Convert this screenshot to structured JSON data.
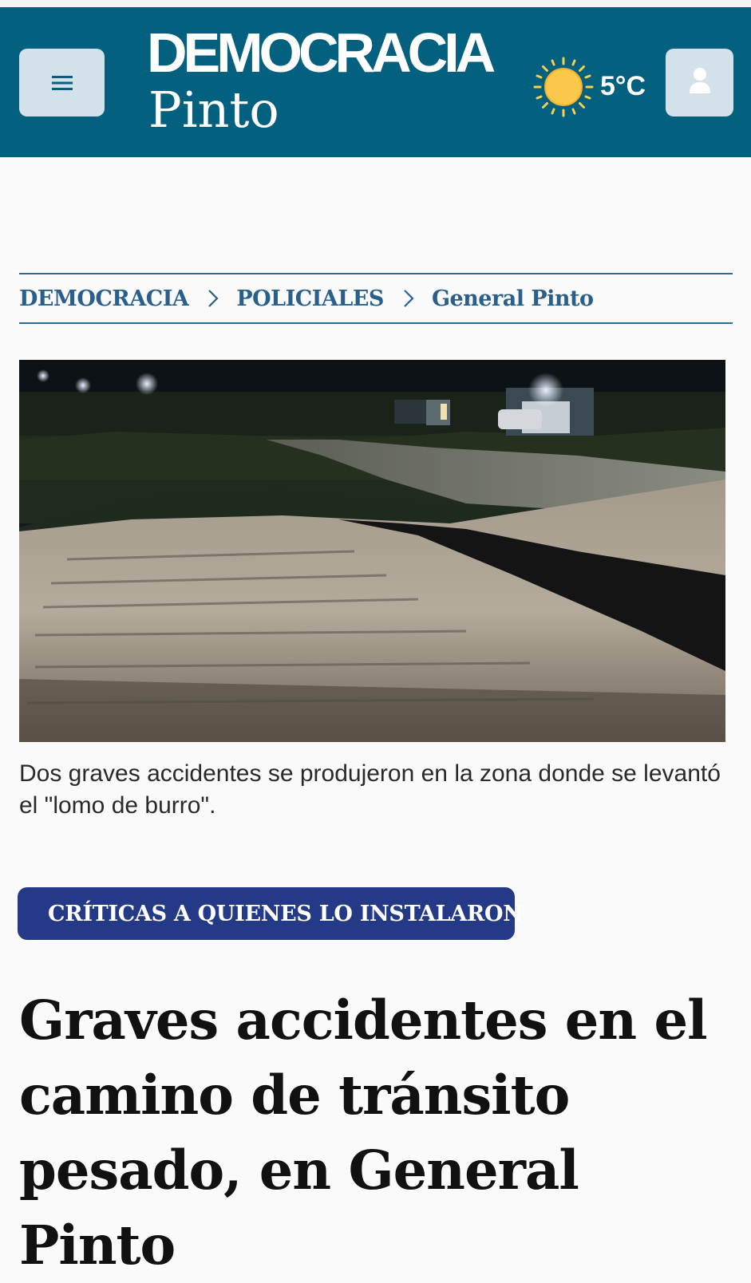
{
  "header": {
    "logo_top": "DEMOCRACIA",
    "logo_bottom": "Pinto",
    "temperature": "5°C",
    "menu_icon": "hamburger-menu-icon",
    "weather_icon": "sun-icon",
    "user_icon": "user-icon",
    "brand_color": "#04607f"
  },
  "breadcrumb": {
    "items": [
      "DEMOCRACIA",
      "POLICIALES",
      "General Pinto"
    ]
  },
  "article": {
    "caption": "Dos graves accidentes se produjeron en la zona donde se levantó el \"lomo de burro\".",
    "badge": "CRÍTICAS A QUIENES LO INSTALARON",
    "headline": "Graves accidentes en el camino de tránsito pesado, en General Pinto"
  },
  "colors": {
    "breadcrumb": "#2a5f8c",
    "badge_bg": "#243a86"
  }
}
